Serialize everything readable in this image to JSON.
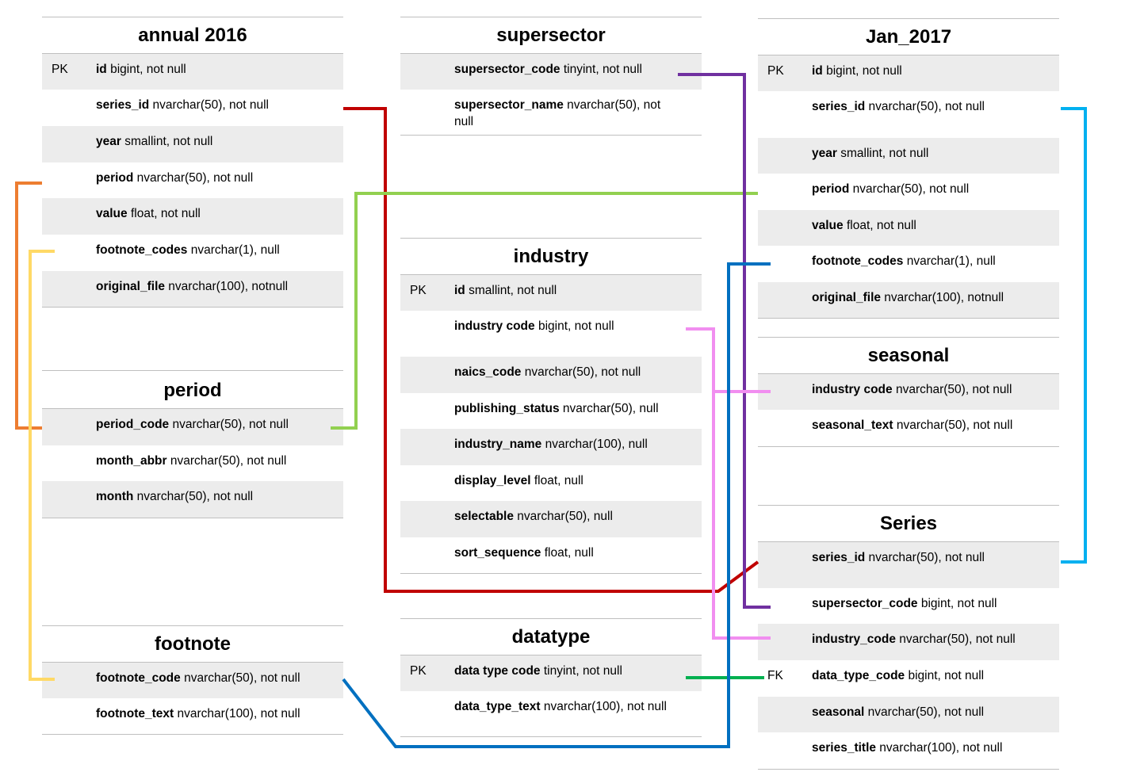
{
  "tables": {
    "annual_2016": {
      "title": "annual 2016",
      "rows": [
        {
          "key": "PK",
          "name": "id",
          "type": " bigint, not null"
        },
        {
          "key": "",
          "name": "series_id",
          "type": " nvarchar(50), not null"
        },
        {
          "key": "",
          "name": "year",
          "type": " smallint, not null"
        },
        {
          "key": "",
          "name": "period",
          "type": " nvarchar(50), not null"
        },
        {
          "key": "",
          "name": "value",
          "type": " float, not null"
        },
        {
          "key": "",
          "name": "footnote_codes",
          "type": " nvarchar(1), null"
        },
        {
          "key": "",
          "name": "original_file",
          "type": " nvarchar(100), notnull"
        }
      ]
    },
    "period": {
      "title": "period",
      "rows": [
        {
          "key": "",
          "name": "period_code",
          "type": " nvarchar(50), not null"
        },
        {
          "key": "",
          "name": "month_abbr",
          "type": " nvarchar(50), not null"
        },
        {
          "key": "",
          "name": "month",
          "type": " nvarchar(50), not null"
        }
      ]
    },
    "footnote": {
      "title": "footnote",
      "rows": [
        {
          "key": "",
          "name": "footnote_code",
          "type": " nvarchar(50), not null"
        },
        {
          "key": "",
          "name": "footnote_text",
          "type": " nvarchar(100), not null"
        }
      ]
    },
    "supersector": {
      "title": "supersector",
      "rows": [
        {
          "key": "",
          "name": "supersector_code",
          "type": " tinyint, not null"
        },
        {
          "key": "",
          "name": "supersector_name",
          "type": " nvarchar(50), not null"
        }
      ]
    },
    "industry": {
      "title": "industry",
      "rows": [
        {
          "key": "PK",
          "name": "id",
          "type": " smallint, not null"
        },
        {
          "key": "",
          "name": "industry code",
          "type": " bigint, not null"
        },
        {
          "key": "",
          "name": "naics_code",
          "type": " nvarchar(50), not null"
        },
        {
          "key": "",
          "name": "publishing_status",
          "type": " nvarchar(50), null"
        },
        {
          "key": "",
          "name": "industry_name",
          "type": " nvarchar(100), null"
        },
        {
          "key": "",
          "name": "display_level",
          "type": " float, null"
        },
        {
          "key": "",
          "name": "selectable",
          "type": " nvarchar(50), null"
        },
        {
          "key": "",
          "name": "sort_sequence",
          "type": " float, null"
        }
      ]
    },
    "datatype": {
      "title": "datatype",
      "rows": [
        {
          "key": "PK",
          "name": "data type code",
          "type": " tinyint, not null"
        },
        {
          "key": "",
          "name": "data_type_text",
          "type": " nvarchar(100), not null"
        }
      ]
    },
    "jan_2017": {
      "title": "Jan_2017",
      "rows": [
        {
          "key": "PK",
          "name": "id",
          "type": " bigint, not null"
        },
        {
          "key": "",
          "name": "series_id",
          "type": " nvarchar(50), not null"
        },
        {
          "key": "",
          "name": "year",
          "type": " smallint, not null"
        },
        {
          "key": "",
          "name": "period",
          "type": " nvarchar(50), not null"
        },
        {
          "key": "",
          "name": "value",
          "type": " float, not null"
        },
        {
          "key": "",
          "name": "footnote_codes",
          "type": " nvarchar(1), null"
        },
        {
          "key": "",
          "name": "original_file",
          "type": " nvarchar(100), notnull"
        }
      ]
    },
    "seasonal": {
      "title": "seasonal",
      "rows": [
        {
          "key": "",
          "name": "industry code",
          "type": " nvarchar(50), not null"
        },
        {
          "key": "",
          "name": "seasonal_text",
          "type": " nvarchar(50), not null"
        }
      ]
    },
    "series": {
      "title": "Series",
      "rows": [
        {
          "key": "",
          "name": "series_id",
          "type": " nvarchar(50), not null"
        },
        {
          "key": "",
          "name": "supersector_code",
          "type": " bigint, not null"
        },
        {
          "key": "",
          "name": "industry_code",
          "type": " nvarchar(50), not null"
        },
        {
          "key": "FK",
          "name": "data_type_code",
          "type": " bigint, not null"
        },
        {
          "key": "",
          "name": "seasonal",
          "type": " nvarchar(50), not null"
        },
        {
          "key": "",
          "name": "series_title",
          "type": " nvarchar(100), not null"
        }
      ]
    }
  },
  "relationships": [
    {
      "from": "annual_2016.series_id",
      "to": "series.series_id",
      "color": "#c00000"
    },
    {
      "from": "annual_2016.period",
      "to": "period.period_code",
      "color": "#ed7d31"
    },
    {
      "from": "annual_2016.footnote_codes",
      "to": "footnote.footnote_code",
      "color": "#ffd966"
    },
    {
      "from": "period.period_code",
      "to": "jan_2017.period",
      "color": "#92d050"
    },
    {
      "from": "supersector.supersector_code",
      "to": "series.supersector_code",
      "color": "#7030a0"
    },
    {
      "from": "industry.industry_code",
      "to": "seasonal.industry_code",
      "color": "#f18ef0"
    },
    {
      "from": "industry.industry_code",
      "to": "series.industry_code",
      "color": "#f18ef0"
    },
    {
      "from": "datatype.data_type_code",
      "to": "series.data_type_code",
      "color": "#00b050"
    },
    {
      "from": "footnote.footnote_code",
      "to": "jan_2017.footnote_codes",
      "color": "#0070c0"
    },
    {
      "from": "jan_2017.series_id",
      "to": "series.series_id",
      "color": "#00b0f0"
    }
  ]
}
